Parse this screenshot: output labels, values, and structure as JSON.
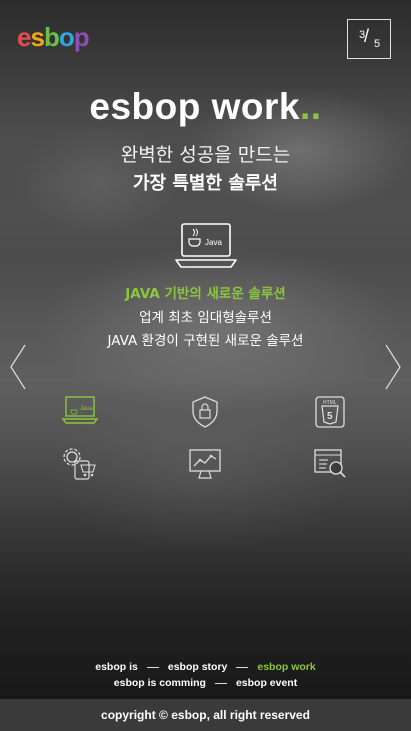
{
  "logo": {
    "parts": [
      "e",
      "s",
      "b",
      "o",
      "p"
    ],
    "colors": [
      "#e8494c",
      "#f3a51d",
      "#6cc04a",
      "#2fa7dd",
      "#8d4fb5"
    ]
  },
  "pager": {
    "current": "3",
    "total": "5"
  },
  "hero": {
    "title": "esbop work",
    "title_dots": "..",
    "subtitle_1": "완벽한 성공을 만드는",
    "subtitle_2": "가장 특별한 솔루션",
    "icon_label": "Java"
  },
  "feature": {
    "title": "JAVA 기반의 새로운 솔루션",
    "line_1": "업계 최초 임대형솔루션",
    "line_2": "JAVA 환경이 구현된 새로운 솔루션"
  },
  "icons": [
    {
      "name": "java-laptop-icon",
      "label": "Java",
      "active": true
    },
    {
      "name": "security-shield-icon",
      "active": false
    },
    {
      "name": "html5-icon",
      "label": "HTML",
      "badge": "5",
      "active": false
    },
    {
      "name": "settings-cart-icon",
      "active": false
    },
    {
      "name": "chart-monitor-icon",
      "active": false
    },
    {
      "name": "document-search-icon",
      "active": false
    }
  ],
  "footer_nav": {
    "row1": [
      "esbop is",
      "esbop story",
      "esbop work"
    ],
    "row2": [
      "esbop is comming",
      "esbop event"
    ],
    "active": "esbop work"
  },
  "copyright": "copyright © esbop, all right reserved",
  "colors": {
    "accent": "#8cc63f",
    "footer_bg": "#3a3a3a"
  }
}
